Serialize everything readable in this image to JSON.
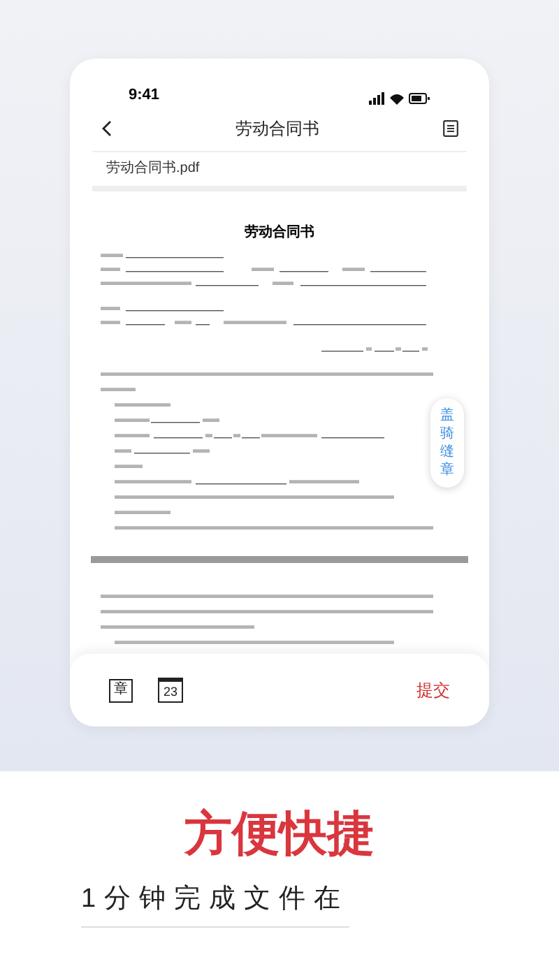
{
  "status_bar": {
    "time": "9:41"
  },
  "nav": {
    "title": "劳动合同书"
  },
  "file_name": "劳动合同书.pdf",
  "document": {
    "title": "劳动合同书"
  },
  "side_button": {
    "label": "盖骑缝章"
  },
  "toolbar": {
    "stamp_label": "章",
    "date_label": "23",
    "submit": "提交"
  },
  "promo": {
    "headline": "方便快捷",
    "subtitle": "1分钟完成文件在"
  }
}
